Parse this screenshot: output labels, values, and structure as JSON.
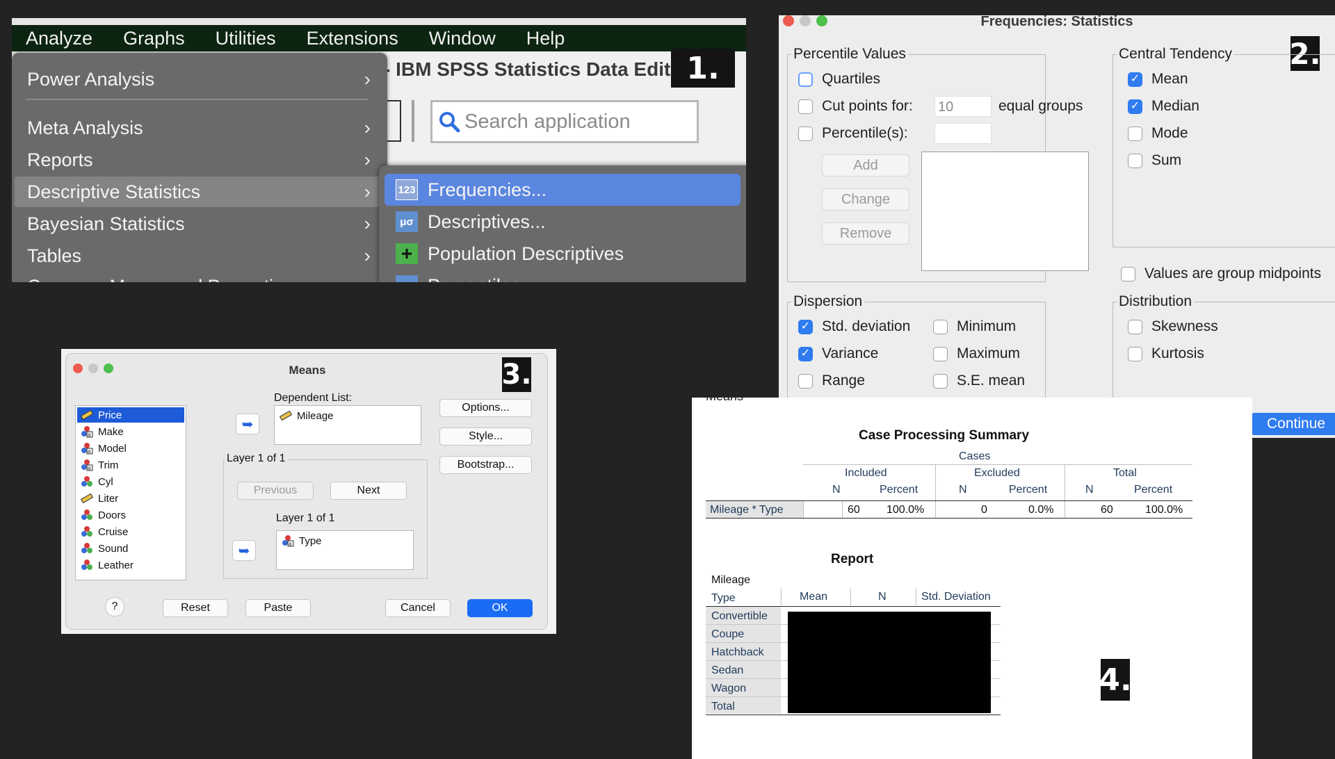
{
  "panel1": {
    "menubar": [
      "Analyze",
      "Graphs",
      "Utilities",
      "Extensions",
      "Window",
      "Help"
    ],
    "window_title": "- IBM SPSS Statistics Data Edit",
    "badge": "1.",
    "search_placeholder": "Search application",
    "analyze_menu": [
      {
        "label": "Power Analysis",
        "chevron": "›"
      },
      {
        "label": "Meta Analysis",
        "chevron": "›"
      },
      {
        "label": "Reports",
        "chevron": "›"
      },
      {
        "label": "Descriptive Statistics",
        "chevron": "›"
      },
      {
        "label": "Bayesian Statistics",
        "chevron": "›"
      },
      {
        "label": "Tables",
        "chevron": "›"
      },
      {
        "label": "Compare Means and Proportions",
        "chevron": "›"
      }
    ],
    "submenu": [
      {
        "label": "Frequencies...",
        "icon": "frequencies-icon"
      },
      {
        "label": "Descriptives...",
        "icon": "descriptives-icon"
      },
      {
        "label": "Population Descriptives",
        "icon": "plus-icon"
      },
      {
        "label": "Percentiles...",
        "icon": "percentiles-icon"
      }
    ]
  },
  "panel2": {
    "title": "Frequencies: Statistics",
    "badge": "2.",
    "percentile_values": {
      "label": "Percentile Values",
      "quartiles": "Quartiles",
      "cut_points": "Cut points for:",
      "cut_points_value": "10",
      "equal_groups": "equal groups",
      "percentiles": "Percentile(s):",
      "add": "Add",
      "change": "Change",
      "remove": "Remove"
    },
    "central_tendency": {
      "label": "Central Tendency",
      "items": [
        {
          "label": "Mean",
          "checked": true
        },
        {
          "label": "Median",
          "checked": true
        },
        {
          "label": "Mode",
          "checked": false
        },
        {
          "label": "Sum",
          "checked": false
        }
      ]
    },
    "group_midpoints": "Values are group midpoints",
    "dispersion": {
      "label": "Dispersion",
      "items": [
        {
          "label": "Std. deviation",
          "checked": true
        },
        {
          "label": "Minimum",
          "checked": false
        },
        {
          "label": "Variance",
          "checked": true
        },
        {
          "label": "Maximum",
          "checked": false
        },
        {
          "label": "Range",
          "checked": false
        },
        {
          "label": "S.E. mean",
          "checked": false
        }
      ]
    },
    "distribution": {
      "label": "Distribution",
      "items": [
        {
          "label": "Skewness",
          "checked": false
        },
        {
          "label": "Kurtosis",
          "checked": false
        }
      ]
    },
    "continue": "Continue"
  },
  "panel3": {
    "title": "Means",
    "badge": "3.",
    "variables": [
      {
        "name": "Price",
        "type": "scale"
      },
      {
        "name": "Make",
        "type": "nominal"
      },
      {
        "name": "Model",
        "type": "nominal"
      },
      {
        "name": "Trim",
        "type": "nominal"
      },
      {
        "name": "Cyl",
        "type": "ordinal"
      },
      {
        "name": "Liter",
        "type": "scale"
      },
      {
        "name": "Doors",
        "type": "ordinal"
      },
      {
        "name": "Cruise",
        "type": "ordinal"
      },
      {
        "name": "Sound",
        "type": "ordinal"
      },
      {
        "name": "Leather",
        "type": "ordinal"
      }
    ],
    "dependent_label": "Dependent List:",
    "dependent_item": "Mileage",
    "layer_group": "Layer 1 of 1",
    "previous": "Previous",
    "next": "Next",
    "layer_label": "Layer 1 of 1",
    "layer_item": "Type",
    "options": "Options...",
    "style": "Style...",
    "bootstrap": "Bootstrap...",
    "help": "?",
    "reset": "Reset",
    "paste": "Paste",
    "cancel": "Cancel",
    "ok": "OK"
  },
  "panel4": {
    "badge": "4.",
    "header_fragment": "Means",
    "cps_title": "Case Processing Summary",
    "cases": "Cases",
    "included": "Included",
    "excluded": "Excluded",
    "total": "Total",
    "n": "N",
    "percent": "Percent",
    "cps_row": {
      "label": "Mileage  * Type",
      "inc_n": "60",
      "inc_pct": "100.0%",
      "exc_n": "0",
      "exc_pct": "0.0%",
      "tot_n": "60",
      "tot_pct": "100.0%"
    },
    "report_title": "Report",
    "report_var": "Mileage",
    "report_headers": [
      "Type",
      "Mean",
      "N",
      "Std. Deviation"
    ],
    "report_rows": [
      "Convertible",
      "Coupe",
      "Hatchback",
      "Sedan",
      "Wagon",
      "Total"
    ]
  }
}
